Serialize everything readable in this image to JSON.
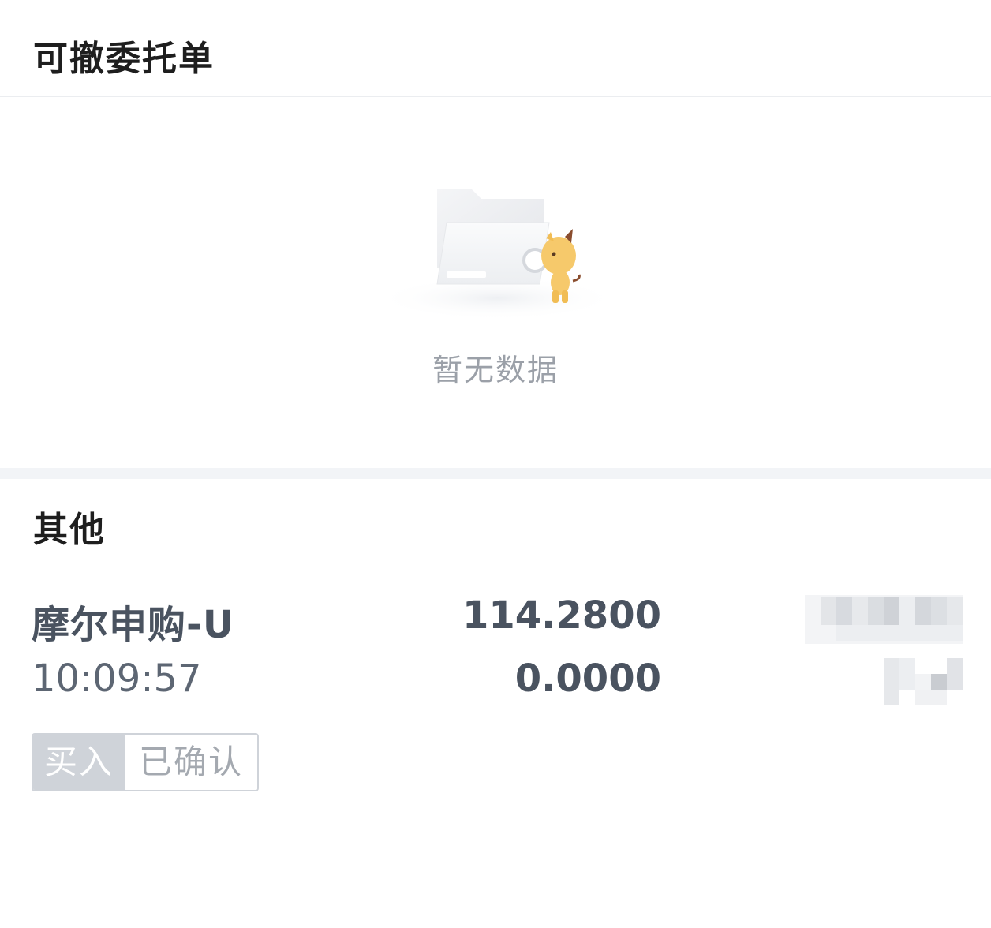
{
  "sections": {
    "cancelable": {
      "title": "可撤委托单",
      "empty_text": "暂无数据"
    },
    "other": {
      "title": "其他"
    }
  },
  "orders": [
    {
      "name": "摩尔申购-U",
      "time": "10:09:57",
      "price": "114.2800",
      "amount": "0.0000",
      "action_tag": "买入",
      "status_tag": "已确认"
    }
  ],
  "icons": {
    "empty": "empty-folder-mascot-icon"
  },
  "colors": {
    "title": "#1e1e1e",
    "muted_text": "#9ba0a8",
    "row_text": "#4a5360",
    "tag_fill": "#cfd3d9",
    "band": "#f2f4f7"
  }
}
